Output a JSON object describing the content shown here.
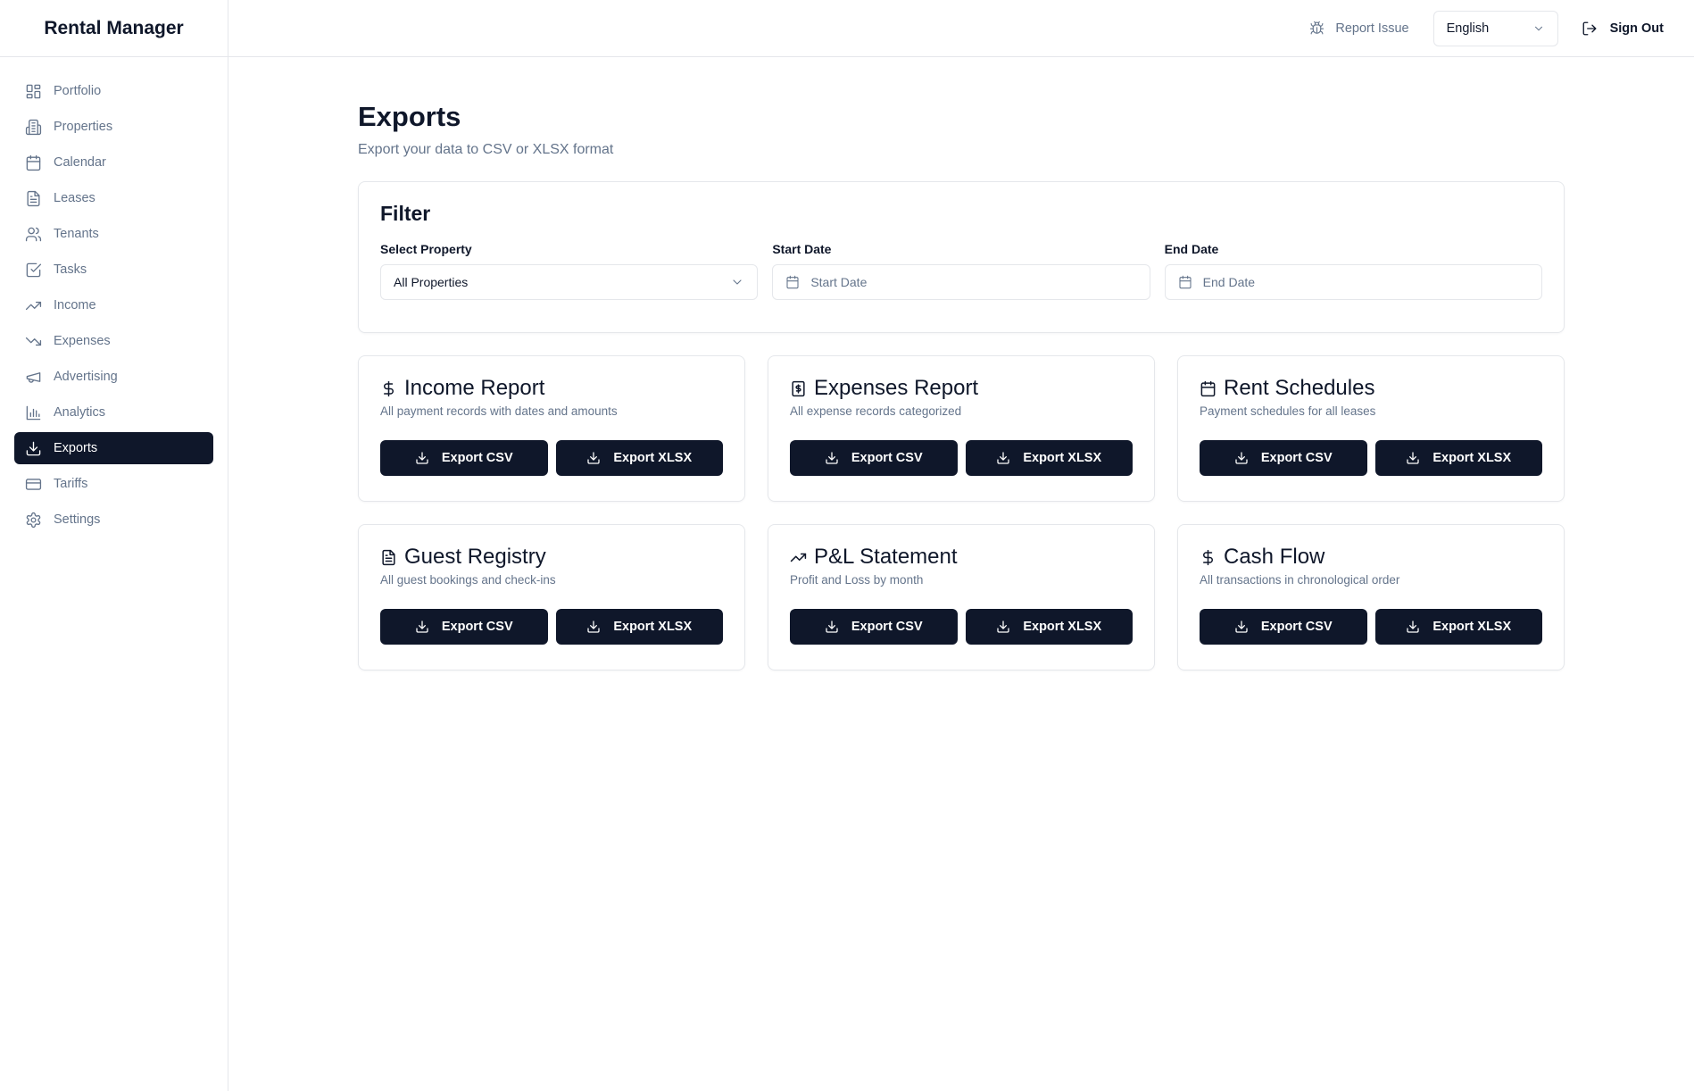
{
  "app": {
    "title": "Rental Manager"
  },
  "sidebar": {
    "items": [
      {
        "label": "Portfolio",
        "icon": "grid-icon"
      },
      {
        "label": "Properties",
        "icon": "building-icon"
      },
      {
        "label": "Calendar",
        "icon": "calendar-icon"
      },
      {
        "label": "Leases",
        "icon": "document-icon"
      },
      {
        "label": "Tenants",
        "icon": "users-icon"
      },
      {
        "label": "Tasks",
        "icon": "checkbox-icon"
      },
      {
        "label": "Income",
        "icon": "trending-up-icon"
      },
      {
        "label": "Expenses",
        "icon": "trending-down-icon"
      },
      {
        "label": "Advertising",
        "icon": "megaphone-icon"
      },
      {
        "label": "Analytics",
        "icon": "bar-chart-icon"
      },
      {
        "label": "Exports",
        "icon": "download-icon",
        "active": true
      },
      {
        "label": "Tariffs",
        "icon": "credit-card-icon"
      },
      {
        "label": "Settings",
        "icon": "gear-icon"
      }
    ]
  },
  "header": {
    "report_issue": "Report Issue",
    "language": "English",
    "sign_out": "Sign Out"
  },
  "page": {
    "title": "Exports",
    "subtitle": "Export your data to CSV or XLSX format"
  },
  "filter": {
    "title": "Filter",
    "property_label": "Select Property",
    "property_value": "All Properties",
    "start_label": "Start Date",
    "start_placeholder": "Start Date",
    "end_label": "End Date",
    "end_placeholder": "End Date"
  },
  "cards": [
    {
      "title": "Income Report",
      "desc": "All payment records with dates and amounts",
      "icon": "dollar-icon",
      "csv": "Export CSV",
      "xlsx": "Export XLSX"
    },
    {
      "title": "Expenses Report",
      "desc": "All expense records categorized",
      "icon": "receipt-icon",
      "csv": "Export CSV",
      "xlsx": "Export XLSX"
    },
    {
      "title": "Rent Schedules",
      "desc": "Payment schedules for all leases",
      "icon": "calendar-icon",
      "csv": "Export CSV",
      "xlsx": "Export XLSX"
    },
    {
      "title": "Guest Registry",
      "desc": "All guest bookings and check-ins",
      "icon": "document-icon",
      "csv": "Export CSV",
      "xlsx": "Export XLSX"
    },
    {
      "title": "P&L Statement",
      "desc": "Profit and Loss by month",
      "icon": "trending-up-icon",
      "csv": "Export CSV",
      "xlsx": "Export XLSX"
    },
    {
      "title": "Cash Flow",
      "desc": "All transactions in chronological order",
      "icon": "dollar-icon",
      "csv": "Export CSV",
      "xlsx": "Export XLSX"
    }
  ],
  "colors": {
    "primary": "#0f172a",
    "muted_text": "#64748b",
    "border": "#e5e7eb",
    "background": "#ffffff"
  }
}
